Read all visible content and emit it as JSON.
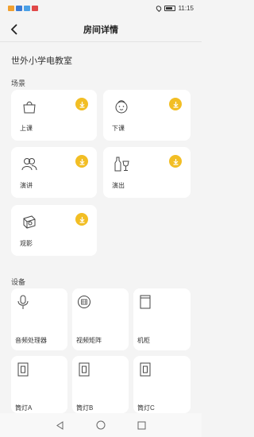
{
  "status": {
    "time": "11:15",
    "notification_icons": [
      "#f0a030",
      "#3a7bd5",
      "#4aa0e6",
      "#e04848"
    ]
  },
  "header": {
    "title": "房间详情",
    "back_icon": "chevron-left-icon"
  },
  "room": {
    "name": "世外小学电教室"
  },
  "scenes": {
    "label": "场景",
    "accent": "#f2be24",
    "items": [
      {
        "label": "上课",
        "icon": "bag-icon"
      },
      {
        "label": "下课",
        "icon": "child-face-icon"
      },
      {
        "label": "演讲",
        "icon": "people-icon"
      },
      {
        "label": "演出",
        "icon": "bottle-glass-icon"
      },
      {
        "label": "观影",
        "icon": "projector-icon"
      }
    ]
  },
  "devices": {
    "label": "设备",
    "items": [
      {
        "label": "音频处理器",
        "icon": "microphone-icon"
      },
      {
        "label": "视频矩阵",
        "icon": "matrix-icon"
      },
      {
        "label": "机柜",
        "icon": "cabinet-icon"
      },
      {
        "label": "筒灯A",
        "icon": "light-switch-icon"
      },
      {
        "label": "筒灯B",
        "icon": "light-switch-icon"
      },
      {
        "label": "筒灯C",
        "icon": "light-switch-icon"
      }
    ]
  },
  "navbar": {
    "buttons": [
      "back-triangle-icon",
      "home-circle-icon",
      "recent-square-icon"
    ]
  }
}
